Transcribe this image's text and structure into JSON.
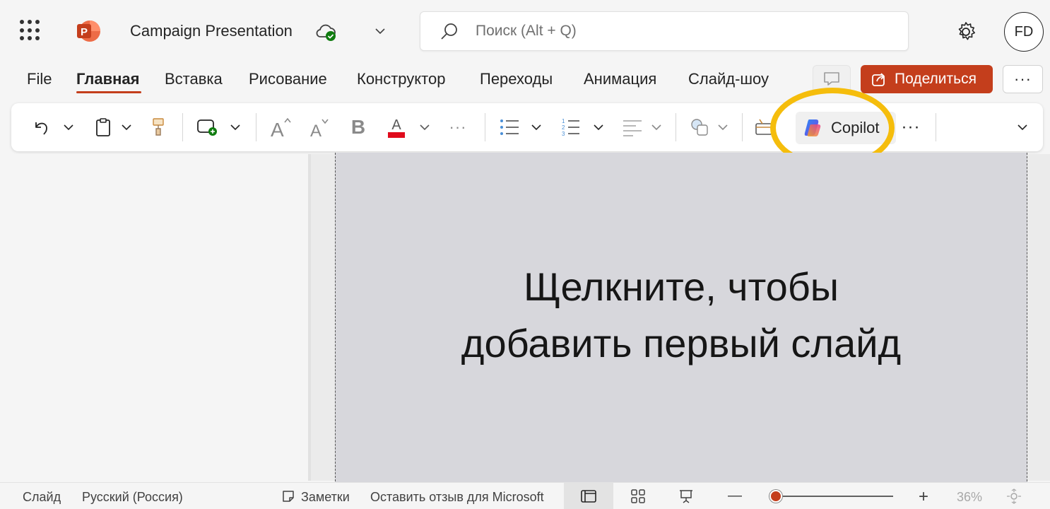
{
  "app": {
    "title": "Campaign Presentation",
    "search_placeholder": "Поиск (Alt + Q)",
    "user_initials": "FD"
  },
  "tabs": [
    {
      "label": "File",
      "active": false
    },
    {
      "label": "Главная",
      "active": true
    },
    {
      "label": "Вставка",
      "active": false
    },
    {
      "label": "Рисование",
      "active": false
    },
    {
      "label": "Конструктор",
      "active": false
    },
    {
      "label": "Переходы",
      "active": false
    },
    {
      "label": "Анимация",
      "active": false
    },
    {
      "label": "Слайд-шоу",
      "active": false
    }
  ],
  "actions": {
    "share_label": "Поделиться",
    "more_label": "···"
  },
  "ribbon": {
    "copilot_label": "Copilot",
    "bold_label": "B",
    "font_grow_label": "A",
    "font_shrink_label": "A",
    "font_color_label": "A",
    "more_label": "···"
  },
  "slide": {
    "placeholder_line1": "Щелкните, чтобы",
    "placeholder_line2": "добавить первый слайд"
  },
  "status_bar": {
    "slide_label": "Слайд",
    "language": "Русский (Россия)",
    "notes_label": "Заметки",
    "feedback_label": "Оставить отзыв для Microsoft",
    "zoom_minus": "—",
    "zoom_plus": "+",
    "zoom_level": "36%"
  },
  "colors": {
    "brand": "#c43e1c",
    "highlight": "#f5bd0c",
    "font_color_swatch": "#e00b1c"
  }
}
